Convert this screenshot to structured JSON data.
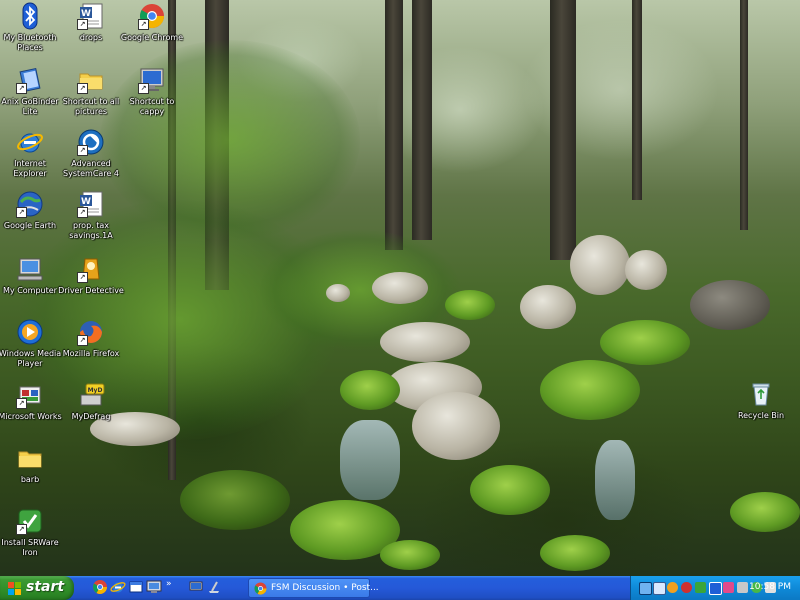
{
  "desktop": {
    "icons": [
      {
        "label": "My Bluetooth Places",
        "icon": "bluetooth-icon"
      },
      {
        "label": "drops",
        "icon": "word-document-icon"
      },
      {
        "label": "Google Chrome",
        "icon": "chrome-icon"
      },
      {
        "label": "Anix GoBinder Lite",
        "icon": "gobinder-icon"
      },
      {
        "label": "Shortcut to all pictures",
        "icon": "folder-icon"
      },
      {
        "label": "Shortcut to cappy",
        "icon": "monitor-icon"
      },
      {
        "label": "Internet Explorer",
        "icon": "internet-explorer-icon"
      },
      {
        "label": "Advanced SystemCare 4",
        "icon": "advanced-systemcare-icon"
      },
      {
        "label": "Google Earth",
        "icon": "google-earth-icon"
      },
      {
        "label": "prop. tax savings.1A",
        "icon": "word-document-icon"
      },
      {
        "label": "My Computer",
        "icon": "my-computer-icon"
      },
      {
        "label": "Driver Detective",
        "icon": "driver-detective-icon"
      },
      {
        "label": "Windows Media Player",
        "icon": "media-player-icon"
      },
      {
        "label": "Mozilla Firefox",
        "icon": "firefox-icon"
      },
      {
        "label": "Microsoft Works",
        "icon": "microsoft-works-icon"
      },
      {
        "label": "MyDefrag",
        "icon": "mydefrag-icon"
      },
      {
        "label": "barb",
        "icon": "folder-icon"
      },
      {
        "label": "Install SRWare Iron",
        "icon": "srware-iron-icon"
      },
      {
        "label": "Recycle Bin",
        "icon": "recycle-bin-icon"
      }
    ]
  },
  "taskbar": {
    "start_label": "start",
    "quick_launch": [
      "chrome-icon",
      "internet-explorer-icon",
      "window-icon",
      "desktop-icon",
      "overflow-chevron-icon",
      "monitor-icon",
      "cleanup-icon"
    ],
    "tasks": [
      {
        "label": "FSM Discussion • Post...",
        "icon": "chrome-icon"
      }
    ],
    "tray_icons": [
      "network-icon",
      "shield-icon",
      "volume-icon",
      "security-icon",
      "update-icon",
      "bluetooth-icon",
      "antivirus-icon",
      "printer-icon",
      "messenger-icon",
      "speaker-icon"
    ],
    "clock": "10:58 PM"
  },
  "colors": {
    "taskbar": "#245edc",
    "start_button": "#3c9a34",
    "tray": "#0f8ad8"
  }
}
